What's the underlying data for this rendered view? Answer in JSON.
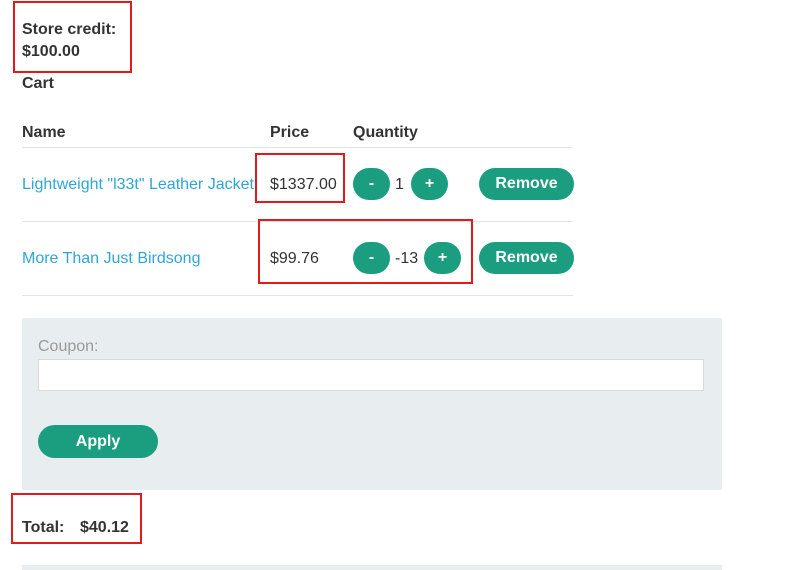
{
  "store_credit": {
    "label": "Store credit:",
    "value": "$100.00"
  },
  "cart": {
    "heading": "Cart",
    "columns": {
      "name": "Name",
      "price": "Price",
      "quantity": "Quantity"
    },
    "items": [
      {
        "name": "Lightweight \"l33t\" Leather Jacket",
        "price": "$1337.00",
        "quantity": "1",
        "minus": "-",
        "plus": "+",
        "remove": "Remove"
      },
      {
        "name": "More Than Just Birdsong",
        "price": "$99.76",
        "quantity": "-13",
        "minus": "-",
        "plus": "+",
        "remove": "Remove"
      }
    ]
  },
  "coupon": {
    "label": "Coupon:",
    "value": "",
    "apply_label": "Apply"
  },
  "total": {
    "label": "Total:",
    "value": "$40.12"
  },
  "colors": {
    "accent": "#1a9e7f",
    "link": "#2fa6d6",
    "panel": "#e8eef0",
    "highlight": "#e11b1b"
  }
}
